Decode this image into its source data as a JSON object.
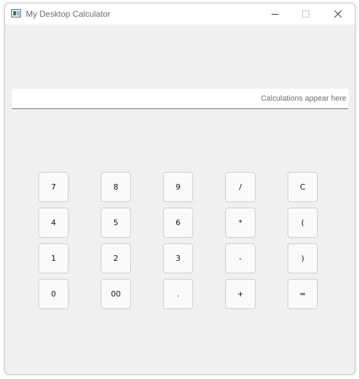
{
  "window": {
    "title": "My Desktop Calculator"
  },
  "display": {
    "placeholder": "Calculations appear here",
    "value": ""
  },
  "keypad": {
    "rows": [
      [
        "7",
        "8",
        "9",
        "/",
        "C"
      ],
      [
        "4",
        "5",
        "6",
        "*",
        "("
      ],
      [
        "1",
        "2",
        "3",
        "-",
        ")"
      ],
      [
        "0",
        "00",
        ".",
        "+",
        "="
      ]
    ]
  },
  "icons": {
    "app": "app-window-icon",
    "minimize": "minimize-icon",
    "maximize": "maximize-icon",
    "close": "close-icon"
  },
  "colors": {
    "window_background": "#f0f0f0",
    "titlebar_background": "#ffffff",
    "button_background": "#fafafa",
    "button_border": "#cdcdcd",
    "title_text": "#6a6a6a"
  }
}
